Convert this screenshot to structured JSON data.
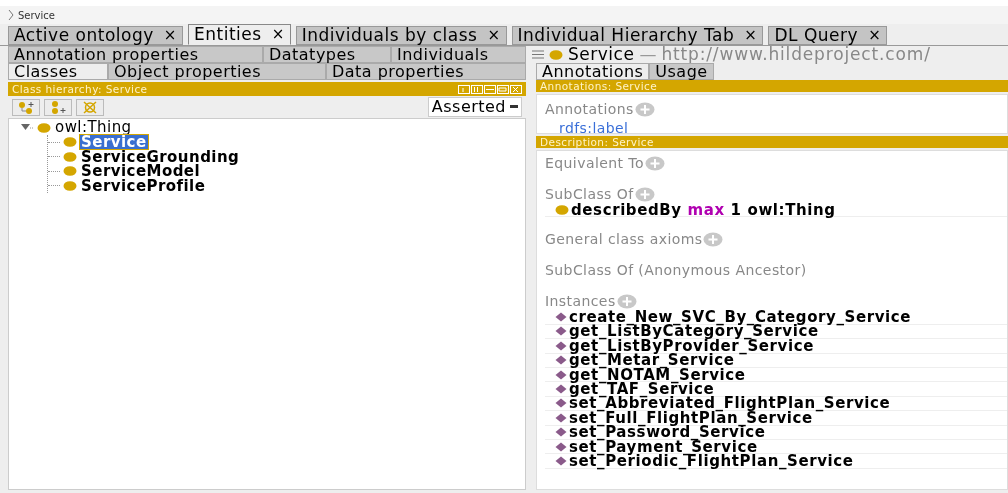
{
  "breadcrumb": "Service",
  "main_tabs": [
    {
      "label": "Active ontology",
      "close": "×",
      "selected": false
    },
    {
      "label": "Entities",
      "close": "×",
      "selected": true
    },
    {
      "label": "Individuals by class",
      "close": "×",
      "selected": false
    },
    {
      "label": "Individual Hierarchy Tab",
      "close": "×",
      "selected": false
    },
    {
      "label": "DL Query",
      "close": "×",
      "selected": false
    }
  ],
  "entity_tabs": {
    "row_1": [
      {
        "label": "Annotation properties",
        "selected": false
      },
      {
        "label": "Datatypes",
        "selected": false
      },
      {
        "label": "Individuals",
        "selected": false
      }
    ],
    "row_2": [
      {
        "label": "Classes",
        "selected": true
      },
      {
        "label": "Object properties",
        "selected": false
      },
      {
        "label": "Data properties",
        "selected": false
      }
    ]
  },
  "class_hierarchy": {
    "title": "Class hierarchy: Service",
    "mode": "Asserted",
    "tree": [
      {
        "label": "owl:Thing",
        "expanded": true,
        "selected": false,
        "children": [
          {
            "label": "Service",
            "selected": true
          },
          {
            "label": "ServiceGrounding",
            "selected": false
          },
          {
            "label": "ServiceModel",
            "selected": false
          },
          {
            "label": "ServiceProfile",
            "selected": false
          }
        ]
      }
    ]
  },
  "entity": {
    "name": "Service",
    "separator": "—",
    "iri": "http://www.hildeproject.com/",
    "tabs": [
      {
        "label": "Annotations",
        "selected": true
      },
      {
        "label": "Usage",
        "selected": false
      }
    ],
    "annotations_title": "Annotations: Service",
    "annotations": {
      "title": "Annotations",
      "items": [
        "rdfs:label"
      ]
    },
    "description_title": "Description: Service",
    "sections": [
      {
        "title": "Equivalent To",
        "addable": true
      },
      {
        "title": "SubClass Of",
        "addable": true,
        "items": [
          {
            "kind": "class",
            "tokens": [
              {
                "text": "describedBy",
                "kind": "name"
              },
              {
                "text": "max",
                "kind": "keyword"
              },
              {
                "text": "1 owl:Thing",
                "kind": "name"
              }
            ]
          }
        ]
      },
      {
        "title": "General class axioms",
        "addable": true
      },
      {
        "title": "SubClass Of (Anonymous Ancestor)",
        "addable": false
      },
      {
        "title": "Instances",
        "addable": true,
        "items": [
          {
            "kind": "individual",
            "tokens": [
              {
                "text": "create_New_SVC_By_Category_Service",
                "kind": "name"
              }
            ]
          },
          {
            "kind": "individual",
            "tokens": [
              {
                "text": "get_ListByCategory_Service",
                "kind": "name"
              }
            ]
          },
          {
            "kind": "individual",
            "tokens": [
              {
                "text": "get_ListByProvider_Service",
                "kind": "name"
              }
            ]
          },
          {
            "kind": "individual",
            "tokens": [
              {
                "text": "get_Metar_Service",
                "kind": "name"
              }
            ]
          },
          {
            "kind": "individual",
            "tokens": [
              {
                "text": "get_NOTAM_Service",
                "kind": "name"
              }
            ]
          },
          {
            "kind": "individual",
            "tokens": [
              {
                "text": "get_TAF_Service",
                "kind": "name"
              }
            ]
          },
          {
            "kind": "individual",
            "tokens": [
              {
                "text": "set_Abbreviated_FlightPlan_Service",
                "kind": "name"
              }
            ]
          },
          {
            "kind": "individual",
            "tokens": [
              {
                "text": "set_Full_FlightPlan_Service",
                "kind": "name"
              }
            ]
          },
          {
            "kind": "individual",
            "tokens": [
              {
                "text": "set_Password_Service",
                "kind": "name"
              }
            ]
          },
          {
            "kind": "individual",
            "tokens": [
              {
                "text": "set_Payment_Service",
                "kind": "name"
              }
            ]
          },
          {
            "kind": "individual",
            "tokens": [
              {
                "text": "set_Periodic_FlightPlan_Service",
                "kind": "name"
              }
            ]
          }
        ]
      }
    ]
  }
}
